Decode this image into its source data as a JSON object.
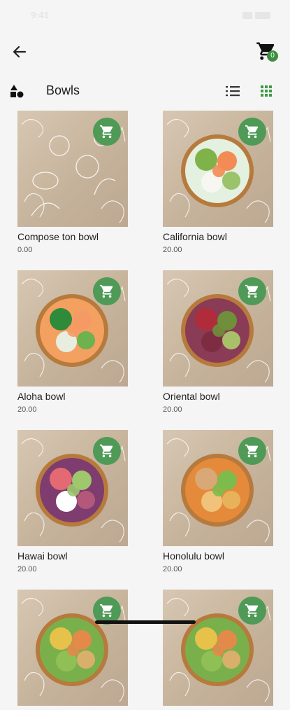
{
  "status_bar": {
    "time": "9:41"
  },
  "header": {
    "cart_count": "0"
  },
  "category": {
    "title": "Bowls"
  },
  "colors": {
    "accent": "#4e9a56",
    "background": "#f5f5f5",
    "bowl_rim": "#b77a3d"
  },
  "products": [
    {
      "name": "Compose ton bowl",
      "price": "0.00",
      "image": "sketch-illustration"
    },
    {
      "name": "California bowl",
      "price": "20.00",
      "image": "bowl-salmon-avocado"
    },
    {
      "name": "Aloha bowl",
      "price": "20.00",
      "image": "bowl-shrimp-carrot"
    },
    {
      "name": "Oriental bowl",
      "price": "20.00",
      "image": "bowl-falafel-cabbage"
    },
    {
      "name": "Hawai bowl",
      "price": "20.00",
      "image": "bowl-tuna-onion"
    },
    {
      "name": "Honolulu bowl",
      "price": "20.00",
      "image": "bowl-chicken-carrot"
    },
    {
      "name": "",
      "price": "",
      "image": "bowl-partial"
    },
    {
      "name": "",
      "price": "",
      "image": "bowl-partial"
    }
  ],
  "icons": {
    "back": "arrow-left-icon",
    "cart": "shopping-cart-icon",
    "category": "shapes-icon",
    "list_view": "list-view-icon",
    "grid_view": "grid-view-icon",
    "add_to_cart": "add-cart-icon"
  }
}
